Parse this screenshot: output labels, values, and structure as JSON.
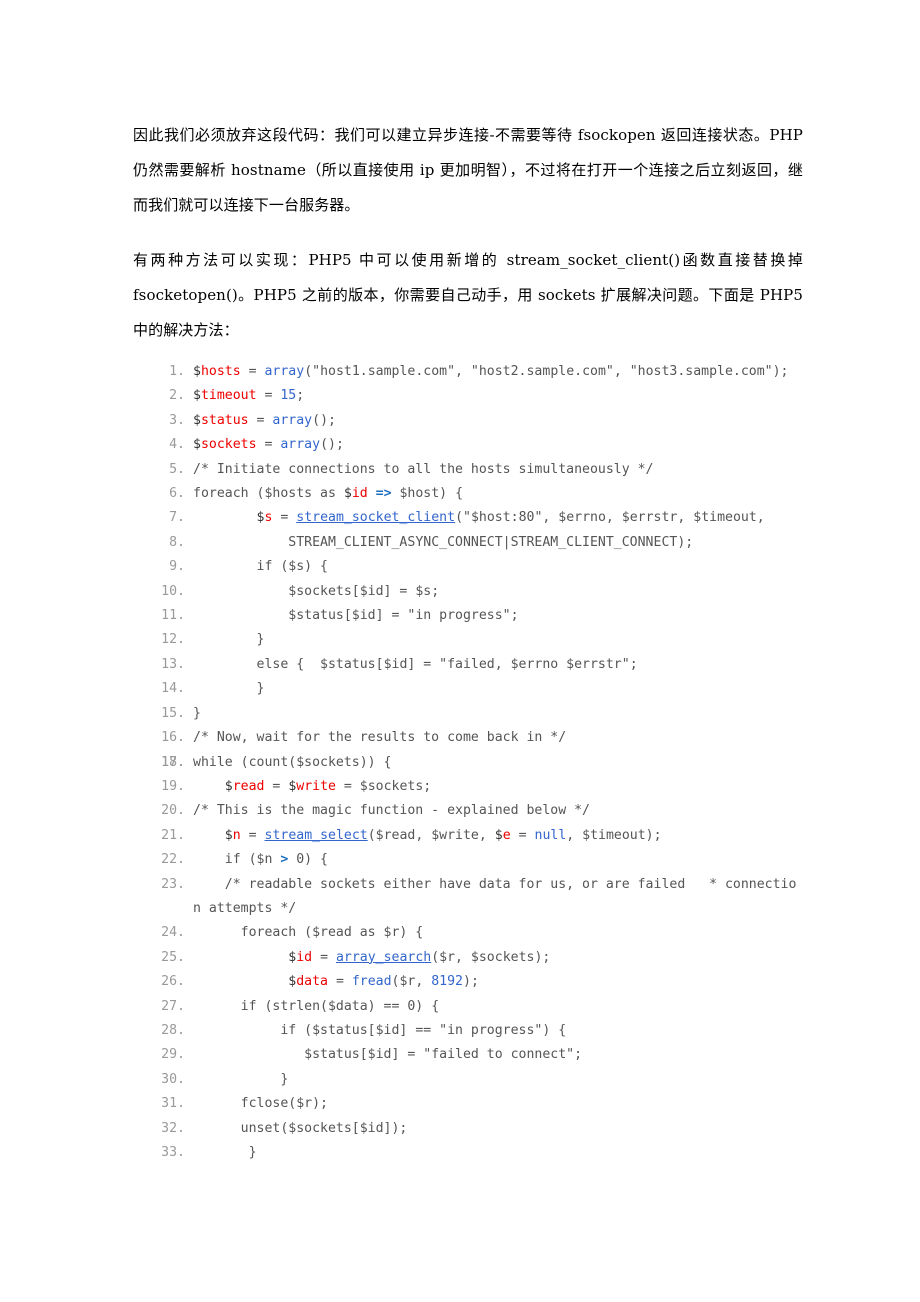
{
  "document": {
    "paragraphs": [
      "因此我们必须放弃这段代码：我们可以建立异步连接-不需要等待 fsockopen 返回连接状态。PHP 仍然需要解析 hostname（所以直接使用 ip 更加明智），不过将在打开一个连接之后立刻返回，继而我们就可以连接下一台服务器。",
      "有两种方法可以实现：PHP5 中可以使用新增的 stream_socket_client()函数直接替换掉 fsocketopen()。PHP5 之前的版本，你需要自己动手，用 sockets 扩展解决问题。下面是 PHP5 中的解决方法："
    ],
    "code": {
      "language": "php",
      "colors": {
        "variable": "#ee0000",
        "function": "#3366cc",
        "number": "#3366cc",
        "operator": "#1f6fbf",
        "default": "#555555",
        "line_number": "#999999",
        "background": "#ffffff"
      },
      "lines": [
        {
          "num": "1",
          "text": "$hosts = array(\"host1.sample.com\", \"host2.sample.com\", \"host3.sample.com\");"
        },
        {
          "num": "2",
          "text": "$timeout = 15;"
        },
        {
          "num": "3",
          "text": "$status = array();"
        },
        {
          "num": "4",
          "text": "$sockets = array();"
        },
        {
          "num": "5",
          "text": "/* Initiate connections to all the hosts simultaneously */"
        },
        {
          "num": "6",
          "text": "foreach ($hosts as $id => $host) {"
        },
        {
          "num": "7",
          "text": "        $s = stream_socket_client(\"$host:80\", $errno, $errstr, $timeout,"
        },
        {
          "num": "8",
          "text": "            STREAM_CLIENT_ASYNC_CONNECT|STREAM_CLIENT_CONNECT);"
        },
        {
          "num": "9",
          "text": "        if ($s) {"
        },
        {
          "num": "10",
          "text": "            $sockets[$id] = $s;"
        },
        {
          "num": "11",
          "text": "            $status[$id] = \"in progress\";"
        },
        {
          "num": "12",
          "text": "        }"
        },
        {
          "num": "13",
          "text": "        else {  $status[$id] = \"failed, $errno $errstr\";"
        },
        {
          "num": "14",
          "text": "        }"
        },
        {
          "num": "15",
          "text": "}"
        },
        {
          "num": "16",
          "text": "/* Now, wait for the results to come back in */"
        },
        {
          "num": "17",
          "text": ""
        },
        {
          "num": "18",
          "text": "while (count($sockets)) {"
        },
        {
          "num": "19",
          "text": "    $read = $write = $sockets;"
        },
        {
          "num": "20",
          "text": "/* This is the magic function - explained below */"
        },
        {
          "num": "21",
          "text": "    $n = stream_select($read, $write, $e = null, $timeout);"
        },
        {
          "num": "22",
          "text": "    if ($n > 0) {"
        },
        {
          "num": "23",
          "text": "    /* readable sockets either have data for us, or are failed   * connection attempts */"
        },
        {
          "num": "24",
          "text": "      foreach ($read as $r) {"
        },
        {
          "num": "25",
          "text": "            $id = array_search($r, $sockets);"
        },
        {
          "num": "26",
          "text": "            $data = fread($r, 8192);"
        },
        {
          "num": "27",
          "text": "      if (strlen($data) == 0) {"
        },
        {
          "num": "28",
          "text": "           if ($status[$id] == \"in progress\") {"
        },
        {
          "num": "29",
          "text": "              $status[$id] = \"failed to connect\";"
        },
        {
          "num": "30",
          "text": "           }"
        },
        {
          "num": "31",
          "text": "      fclose($r);"
        },
        {
          "num": "32",
          "text": "      unset($sockets[$id]);"
        },
        {
          "num": "33",
          "text": "       }"
        }
      ],
      "html_lines": [
        "<span class=\"d\">$</span><span class=\"v\">hosts</span> = <span class=\"f\">array</span>(\"host1.sample.com\", \"host2.sample.com\", \"host3.sample.com\");",
        "<span class=\"d\">$</span><span class=\"v\">timeout</span> = <span class=\"n\">15</span>;",
        "<span class=\"d\">$</span><span class=\"v\">status</span> = <span class=\"f\">array</span>();",
        "<span class=\"d\">$</span><span class=\"v\">sockets</span> = <span class=\"f\">array</span>();",
        "/* Initiate connections to all the hosts simultaneously */",
        "foreach ($hosts as <span class=\"d\">$</span><span class=\"v\">id</span> <span class=\"op\">=&gt;</span> $host) {",
        "        <span class=\"d\">$</span><span class=\"v\">s</span> = <span class=\"fu\">stream_socket_client</span>(\"$host:80\", $errno, $errstr, $timeout,",
        "            STREAM_CLIENT_ASYNC_CONNECT|STREAM_CLIENT_CONNECT);",
        "        if ($s) {",
        "            $sockets[$id] = $s;",
        "            $status[$id] = \"in progress\";",
        "        }",
        "        else {  $status[$id] = \"failed, $errno $errstr\";",
        "        }",
        "}",
        "/* Now, wait for the results to come back in */",
        "",
        "while (count($sockets)) {",
        "    <span class=\"d\">$</span><span class=\"v\">read</span> = <span class=\"d\">$</span><span class=\"v\">write</span> = $sockets;",
        "/* This is the magic function - explained below */",
        "    <span class=\"d\">$</span><span class=\"v\">n</span> = <span class=\"fu\">stream_select</span>($read, $write, <span class=\"d\">$</span><span class=\"v\">e</span> = <span class=\"n\">null</span>, $timeout);",
        "    if ($n <span class=\"op\">&gt;</span> 0) {",
        "    /* readable sockets either have data for us, or are failed   * connection attempts */",
        "      foreach ($read as $r) {",
        "            <span class=\"d\">$</span><span class=\"v\">id</span> = <span class=\"fu\">array_search</span>($r, $sockets);",
        "            <span class=\"d\">$</span><span class=\"v\">data</span> = <span class=\"f\">fread</span>($r, <span class=\"n\">8192</span>);",
        "      if (strlen($data) == 0) {",
        "           if ($status[$id] == \"in progress\") {",
        "              $status[$id] = \"failed to connect\";",
        "           }",
        "      fclose($r);",
        "      unset($sockets[$id]);",
        "       }"
      ]
    }
  }
}
